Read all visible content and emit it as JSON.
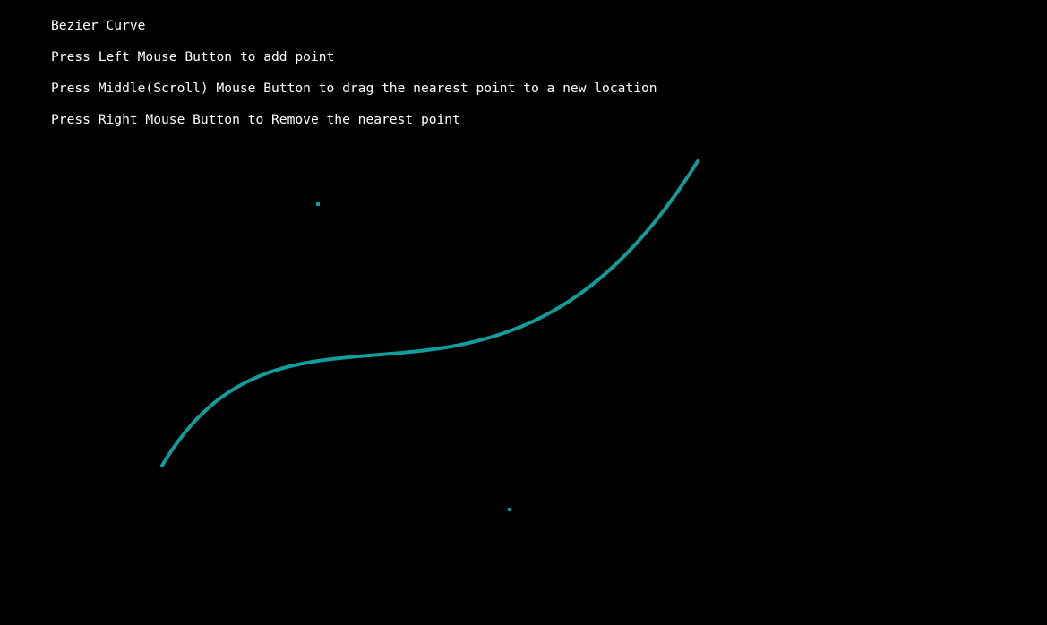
{
  "title": "Bezier Curve",
  "instructions": [
    "Press Left Mouse Button to add point",
    "Press Middle(Scroll) Mouse Button to drag the nearest point to a new location",
    "Press Right Mouse Button to Remove the nearest point"
  ],
  "colors": {
    "background": "#000000",
    "text": "#ffffff",
    "curve": "#129c9c",
    "point": "#129c9c"
  }
}
